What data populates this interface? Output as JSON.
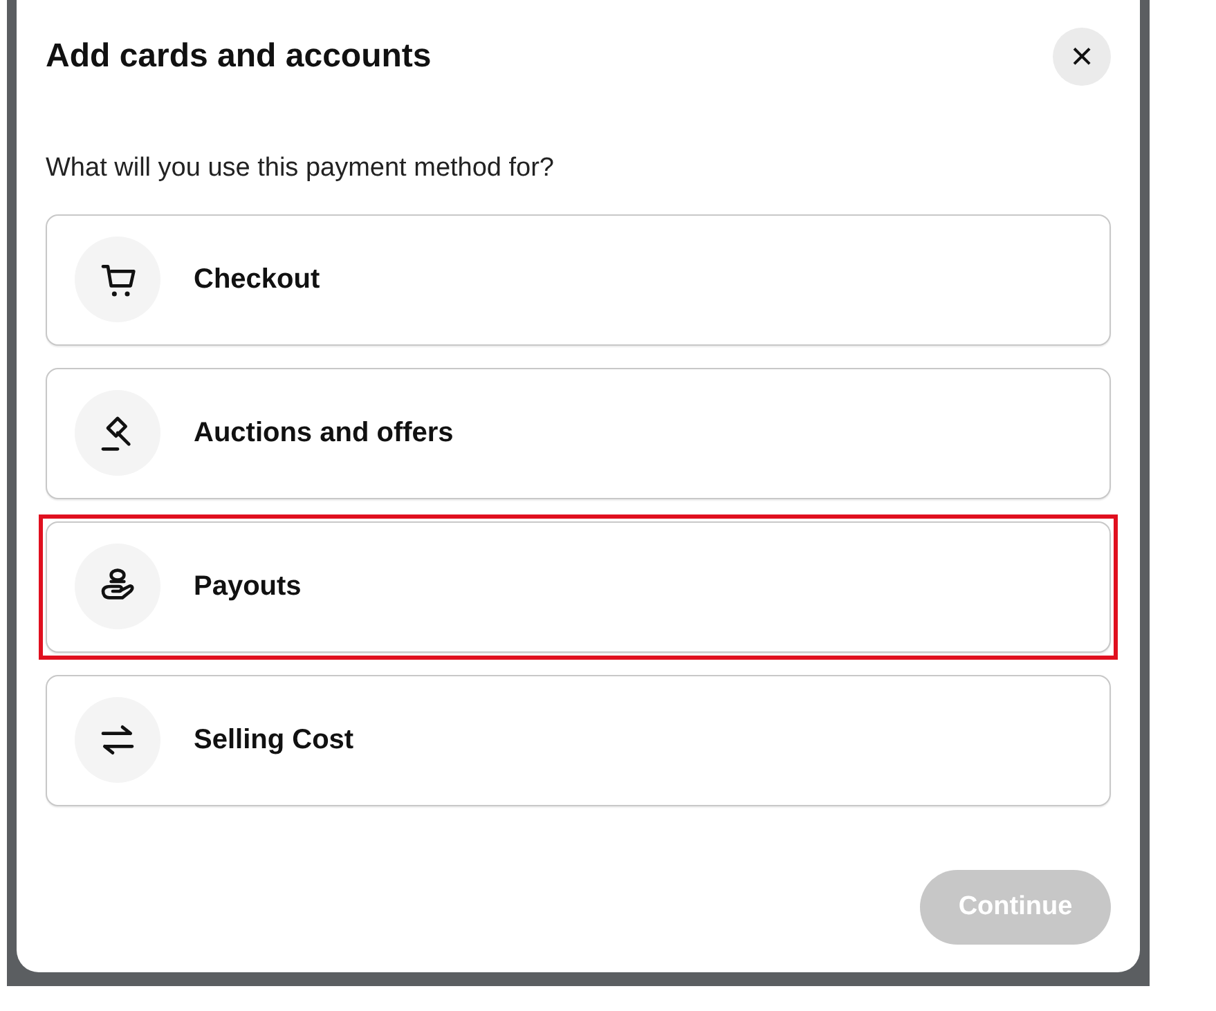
{
  "dialog": {
    "title": "Add cards and accounts",
    "close": "×",
    "prompt": "What will you use this payment method for?",
    "options": [
      {
        "kind": "cart",
        "label": "Checkout",
        "highlighted": false
      },
      {
        "kind": "gavel",
        "label": "Auctions and offers",
        "highlighted": false
      },
      {
        "kind": "payout",
        "label": "Payouts",
        "highlighted": true
      },
      {
        "kind": "transfer",
        "label": "Selling Cost",
        "highlighted": false
      }
    ],
    "continue_button": {
      "label": "Continue",
      "disabled": true
    }
  }
}
